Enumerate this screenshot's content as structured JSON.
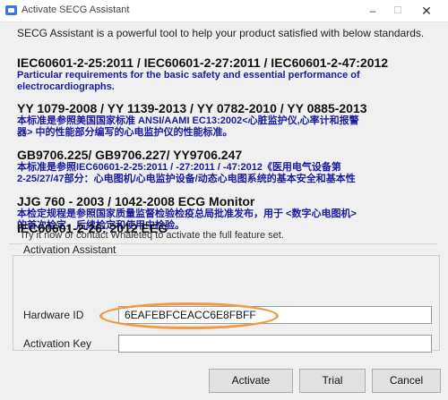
{
  "window": {
    "title": "Activate SECG Assistant",
    "minimize": "–",
    "maximize": "☐",
    "close": "✕"
  },
  "intro": "SECG Assistant is a powerful tool to help your product satisfied with  below standards.",
  "standards": [
    {
      "title": "IEC60601-2-25:2011 / IEC60601-2-27:2011 / IEC60601-2-47:2012",
      "desc_lines": [
        "Particular requirements for the basic safety and essential performance of",
        "electrocardiographs."
      ]
    },
    {
      "title": "YY 1079-2008 / YY 1139-2013 / YY 0782-2010 / YY 0885-2013",
      "desc_lines": [
        "本标准是参照美国国家标准 ANSI/AAMI EC13:2002<心脏监护仪,心率计和报警",
        "器> 中的性能部分编写的心电监护仪的性能标准。"
      ]
    },
    {
      "title": "GB9706.225/ GB9706.227/ YY9706.247",
      "desc_lines": [
        "本标准是参照IEC60601-2-25:2011 / -27:2011 / -47:2012《医用电气设备第",
        "2-25/27/47部分：心电图机/心电监护设备/动态心电图系统的基本安全和基本性"
      ]
    },
    {
      "title": "JJG 760 - 2003 / 1042-2008 ECG Monitor",
      "desc_lines": [
        "本检定规程是参照国家质量监督检验检疫总局批准发布，用于 <数字心电图机>",
        "的首次检定，后续检定和使用中检验。"
      ]
    },
    {
      "title": "IEC60601-2-26: 2012 EEG",
      "desc_lines": []
    }
  ],
  "try_text": "Try it now or contact Whaleteq to activate the full feature set.",
  "activation": {
    "group_label": "Activation Assistant",
    "hardware_id_label": "Hardware ID",
    "hardware_id_value": "6EAFEBFCEACC6E8FBFF",
    "activation_key_label": "Activation Key",
    "activation_key_value": ""
  },
  "buttons": {
    "activate": "Activate",
    "trial": "Trial",
    "cancel": "Cancel"
  },
  "colors": {
    "highlight_ring": "#f29a43",
    "description_text": "#1a1aa0"
  }
}
